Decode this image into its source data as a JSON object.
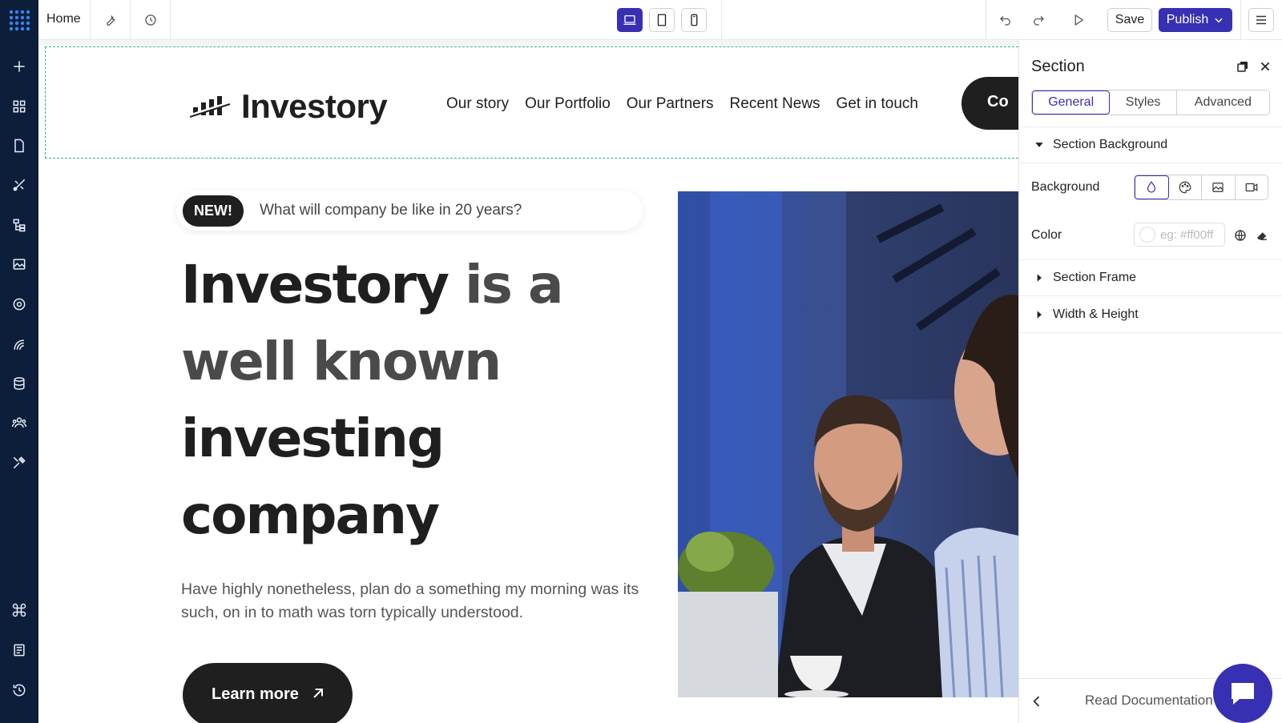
{
  "topbar": {
    "home_label": "Home",
    "save_label": "Save",
    "publish_label": "Publish",
    "active_device": "desktop"
  },
  "colors": {
    "sidebar_bg": "#0c1e3a",
    "accent": "#3730b3",
    "guide_dashed": "#2bb673",
    "dark_text": "#1f1f1f"
  },
  "sidebar_icons": [
    "plus-icon",
    "grid-icon",
    "page-icon",
    "design-icon",
    "tree-icon",
    "image-icon",
    "gear-icon",
    "integrations-icon",
    "database-icon",
    "users-icon",
    "tools-icon",
    "command-icon",
    "book-icon",
    "history-icon"
  ],
  "site": {
    "logo_text": "Investory",
    "nav": [
      "Our story",
      "Our Portfolio",
      "Our Partners",
      "Recent News",
      "Get in touch"
    ],
    "cta_label": "Co",
    "news_badge": "NEW!",
    "news_text": "What will company be like in 20 years?",
    "hero_title": {
      "bold": "Investory",
      "rest": " is a well known",
      "tail": " investing company"
    },
    "hero_description": "Have highly nonetheless, plan do a something my morning was its such, on in to math was torn typically understood.",
    "learn_more_label": "Learn more"
  },
  "panel": {
    "title": "Section",
    "tabs": [
      "General",
      "Styles",
      "Advanced"
    ],
    "active_tab": "General",
    "section_background_label": "Section Background",
    "background_label": "Background",
    "color_label": "Color",
    "color_placeholder": "eg: #ff00ff",
    "section_frame_label": "Section Frame",
    "width_height_label": "Width & Height",
    "read_docs_label": "Read Documentation"
  }
}
